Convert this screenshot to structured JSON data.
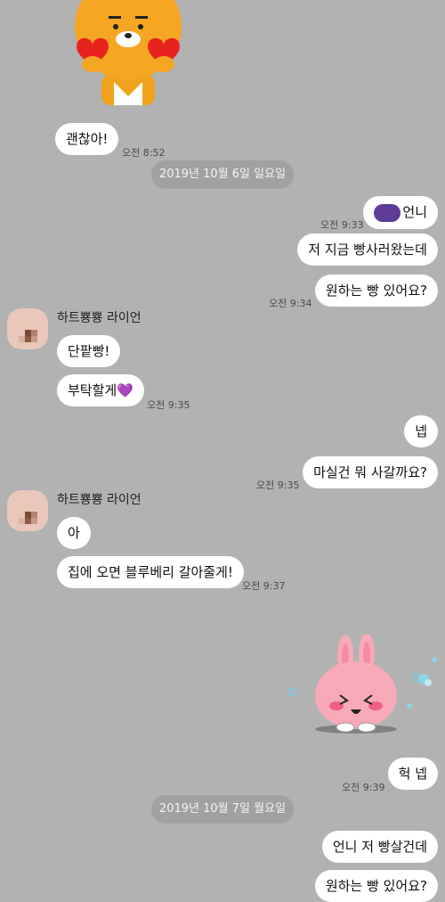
{
  "messages": {
    "m1": {
      "text": "괜찮아!",
      "time": "오전 8:52"
    },
    "date1": "2019년 10월 6일 일요일",
    "m2": {
      "text": "언니",
      "time": "오전 9:33"
    },
    "m3": {
      "text": "저 지금 빵사러왔는데"
    },
    "m4": {
      "text": "원하는 빵 있어요?",
      "time": "오전 9:34"
    },
    "sender_name": "하트뿅뿅 라이언",
    "m5": {
      "text": "단팥빵!"
    },
    "m6": {
      "text": "부탁할게",
      "emoji": "💜",
      "time": "오전 9:35"
    },
    "m7": {
      "text": "넵"
    },
    "m8": {
      "text": "마실건 뭐 사갈까요?",
      "time": "오전 9:35"
    },
    "m9": {
      "text": "아"
    },
    "m10": {
      "text": "집에 오면 블루베리 갈아줄게!",
      "time": "오전 9:37"
    },
    "m11": {
      "text": "헉 넵",
      "time": "오전 9:39"
    },
    "date2": "2019년 10월 7일 월요일",
    "m12": {
      "text": "언니 저 빵살건데"
    },
    "m13": {
      "text": "원하는 빵 있어요?"
    }
  },
  "stickers": {
    "top": "ryan-heart-sticker",
    "bottom": "pink-bunny-sticker"
  },
  "colors": {
    "background": "#b2b2b2",
    "bubble": "#ffffff",
    "date_pill": "#a1a1a1",
    "purple": "#5e3b97"
  }
}
